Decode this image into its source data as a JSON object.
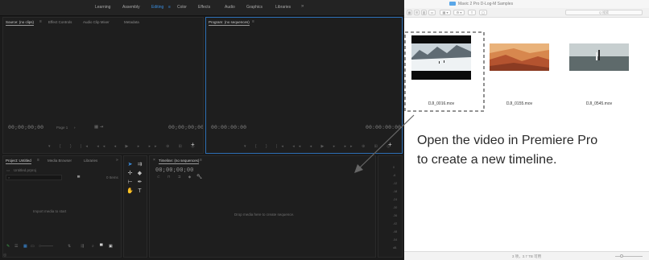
{
  "premiere": {
    "workspaces": [
      {
        "label": "Learning"
      },
      {
        "label": "Assembly"
      },
      {
        "label": "Editing"
      },
      {
        "label": "Color"
      },
      {
        "label": "Effects"
      },
      {
        "label": "Audio"
      },
      {
        "label": "Graphics"
      },
      {
        "label": "Libraries"
      }
    ],
    "overflow_glyph": "»",
    "source_panel": {
      "tabs": [
        "Source: (no clips)",
        "Effect Controls",
        "Audio Clip Mixer",
        "Metadata"
      ],
      "menu_glyph": "≡",
      "timecode_left": "00;00;00;00",
      "timecode_right": "00;00;00;00",
      "fit_label": "Page 1",
      "controls": "▾ { } |◂ ◂◂ ◂ ▶ ▸ ▸▸ ⊕ ⊞ ◎",
      "add_glyph": "+"
    },
    "program_panel": {
      "title": "Program: (no sequences)",
      "menu_glyph": "≡",
      "timecode_left": "00:00:00:00",
      "timecode_right": "00:00:00:00",
      "controls": "▾ { } |◂ ◂◂ ◂ ▶ ▸ ▸▸ ⊕ ⊞ ◎",
      "add_glyph": "+"
    },
    "project_panel": {
      "tabs": [
        "Project: Untitled",
        "Media Browser",
        "Libraries"
      ],
      "menu_glyph": "≡",
      "overflow_glyph": "»",
      "file_name": "Untitled.prproj",
      "items_count": "0 Items",
      "empty_hint": "Import media to start"
    },
    "timeline_panel": {
      "title": "Timeline: (no sequences)",
      "menu_glyph": "≡",
      "close_glyph": "×",
      "timecode": "00;00;00;00",
      "empty_hint": "Drop media here to create sequence."
    },
    "meter_scale": [
      "0",
      "-6",
      "-12",
      "-18",
      "-24",
      "-30",
      "-36",
      "-42",
      "-48",
      "-54",
      "dB"
    ]
  },
  "finder": {
    "title": "Mavic 2 Pro D-Log-M Samples",
    "search_placeholder": "Q 搜索",
    "files": [
      {
        "name": "DJI_0016.mov",
        "selected": true
      },
      {
        "name": "DJI_0155.mov",
        "selected": false
      },
      {
        "name": "DJI_0545.mov",
        "selected": false
      }
    ],
    "status": "3 项，3.7 TB 可用"
  },
  "annotation": {
    "line1": "Open the video in Premiere Pro",
    "line2": "to create a new timeline."
  },
  "colors": {
    "accent_blue": "#3a8dde",
    "panel_border_active": "#2d6fb5",
    "finder_bg": "#ffffff"
  }
}
